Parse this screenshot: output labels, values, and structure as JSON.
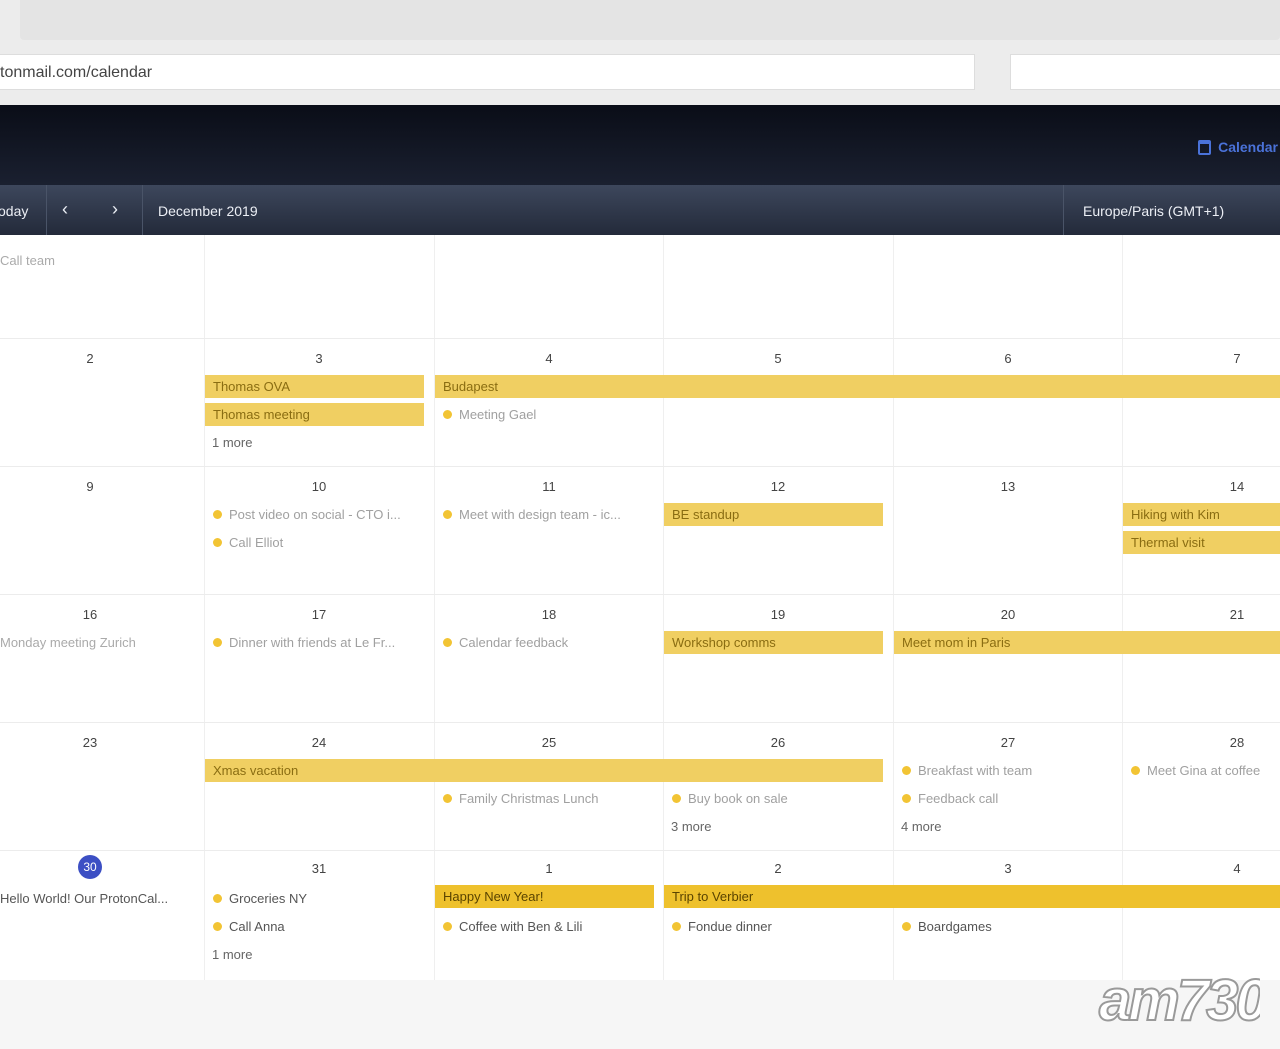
{
  "browser": {
    "url": "tonmail.com/calendar"
  },
  "header": {
    "calendar_link": "Calendar"
  },
  "toolbar": {
    "today_label": "oday",
    "prev_icon": "chevron-left-icon",
    "next_icon": "chevron-right-icon",
    "month_label": "December 2019",
    "timezone": "Europe/Paris (GMT+1)"
  },
  "colors": {
    "event_bar": "#f0cf62",
    "event_bar_strong": "#eec12d",
    "event_dot": "#f2c434",
    "today_circle": "#3c4fc4"
  },
  "calendar": {
    "week0": {
      "call_team": "Call team"
    },
    "week1": {
      "days": [
        "2",
        "3",
        "4",
        "5",
        "6",
        "7"
      ],
      "thomas_ova": "Thomas OVA",
      "thomas_meeting": "Thomas meeting",
      "more_3": "1 more",
      "budapest": "Budapest",
      "meeting_gael": "Meeting Gael"
    },
    "week2": {
      "days": [
        "9",
        "10",
        "11",
        "12",
        "13",
        "14"
      ],
      "post_video": "Post video on social - CTO i...",
      "call_elliot": "Call Elliot",
      "meet_design": "Meet with design team - ic...",
      "be_standup": "BE standup",
      "hiking": "Hiking with Kim",
      "thermal": "Thermal visit"
    },
    "week3": {
      "days": [
        "16",
        "17",
        "18",
        "19",
        "20",
        "21"
      ],
      "monday_meeting": "Monday meeting Zurich",
      "dinner": "Dinner with friends at Le Fr...",
      "calendar_feedback": "Calendar feedback",
      "workshop": "Workshop comms",
      "meet_mom": "Meet mom in Paris"
    },
    "week4": {
      "days": [
        "23",
        "24",
        "25",
        "26",
        "27",
        "28"
      ],
      "xmas": "Xmas vacation",
      "family_lunch": "Family Christmas Lunch",
      "buy_book": "Buy book on sale",
      "more_26": "3 more",
      "breakfast": "Breakfast with team",
      "feedback_call": "Feedback call",
      "more_27": "4 more",
      "meet_gina": "Meet Gina at coffee"
    },
    "week5": {
      "today": "30",
      "days": [
        "31",
        "1",
        "2",
        "3",
        "4"
      ],
      "hello_world": "Hello World! Our ProtonCal...",
      "groceries": "Groceries NY",
      "call_anna": "Call Anna",
      "more_31": "1 more",
      "happy_new_year": "Happy New Year!",
      "coffee": "Coffee with Ben & Lili",
      "trip_verbier": "Trip to Verbier",
      "fondue": "Fondue dinner",
      "boardgames": "Boardgames"
    }
  },
  "watermark": "am730"
}
